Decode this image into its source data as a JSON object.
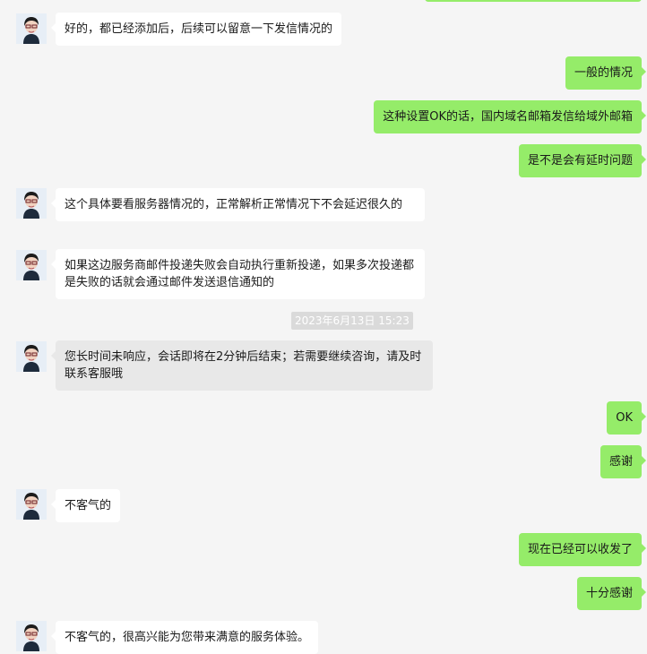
{
  "theme": {
    "background": "#f5f5f5",
    "left_bubble": "#ffffff",
    "right_bubble": "#95ec69",
    "system_bubble": "#e8e8e8",
    "timestamp_bg": "#dadada"
  },
  "avatar": {
    "icon": "person-avatar-icon"
  },
  "messages": [
    {
      "side": "left",
      "text": "好的，都已经添加后，后续可以留意一下发信情况的"
    },
    {
      "side": "right",
      "text": "一般的情况"
    },
    {
      "side": "right",
      "text": "这种设置OK的话，国内域名邮箱发信给域外邮箱"
    },
    {
      "side": "right",
      "text": "是不是会有延时问题"
    },
    {
      "side": "left",
      "text": "这个具体要看服务器情况的，正常解析正常情况下不会延迟很久的"
    },
    {
      "side": "left",
      "text": "如果这边服务商邮件投递失败会自动执行重新投递，如果多次投递都是失败的话就会通过邮件发送退信通知的"
    },
    {
      "side": "timestamp",
      "text": "2023年6月13日 15:23"
    },
    {
      "side": "left",
      "style": "system",
      "text": "您长时间未响应，会话即将在2分钟后结束；若需要继续咨询，请及时联系客服哦"
    },
    {
      "side": "right",
      "text": "OK"
    },
    {
      "side": "right",
      "text": "感谢"
    },
    {
      "side": "left",
      "text": "不客气的"
    },
    {
      "side": "right",
      "text": "现在已经可以收发了"
    },
    {
      "side": "right",
      "text": "十分感谢"
    },
    {
      "side": "left",
      "text": "不客气的，很高兴能为您带来满意的服务体验。"
    }
  ]
}
